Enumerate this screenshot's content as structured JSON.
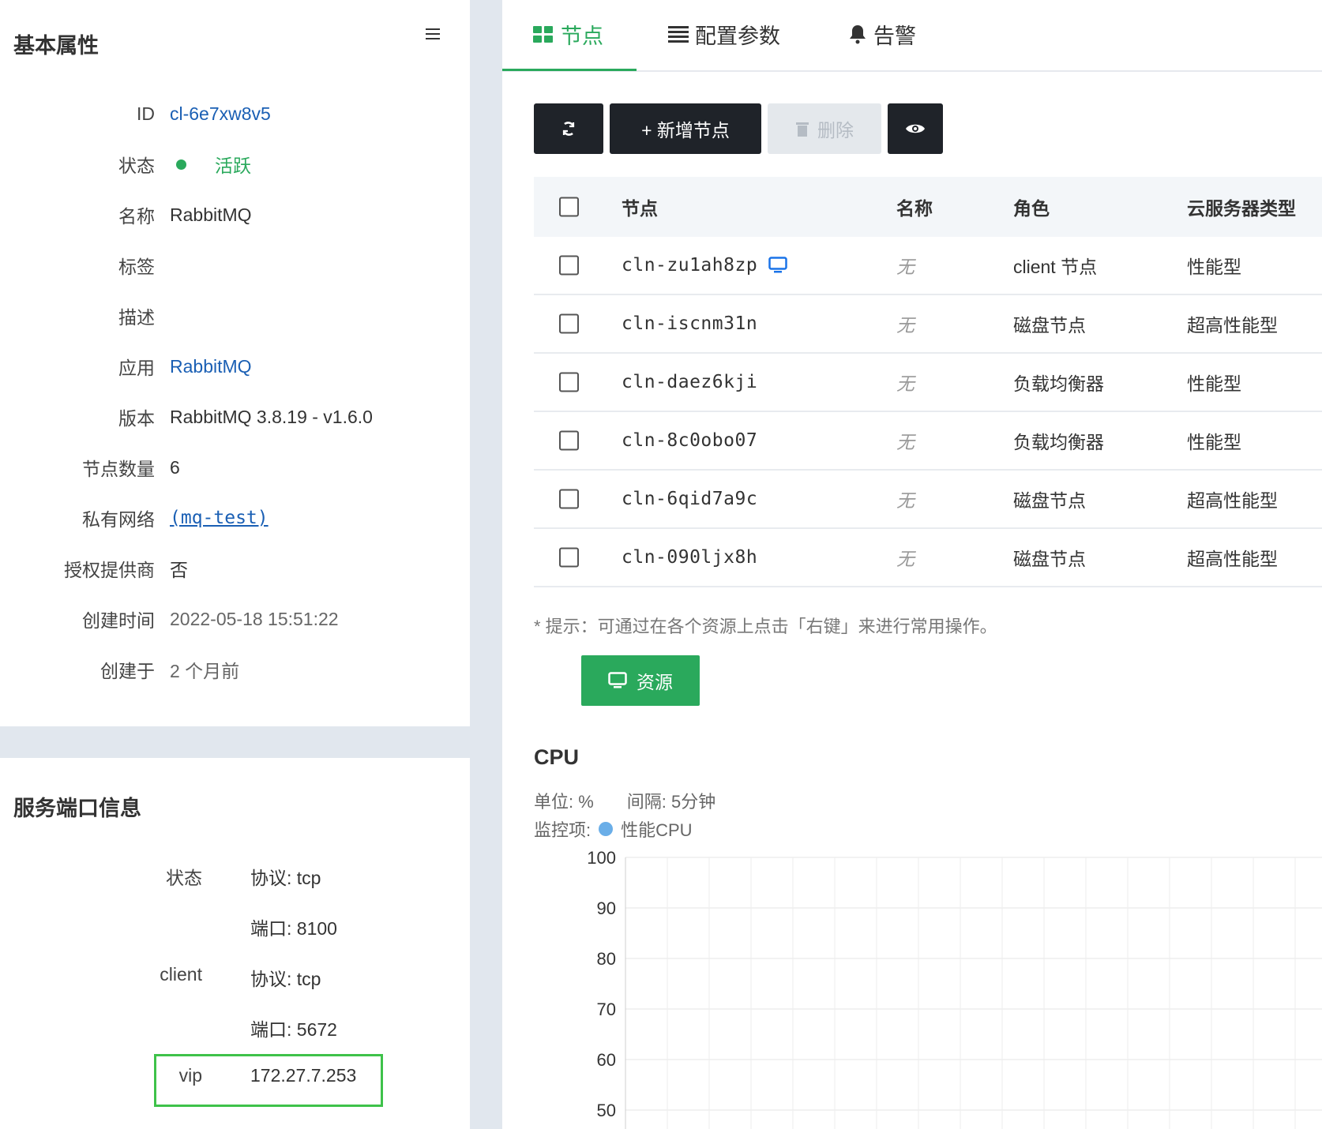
{
  "basic": {
    "title": "基本属性",
    "rows": [
      {
        "label": "ID",
        "value": "cl-6e7xw8v5"
      },
      {
        "label": "状态",
        "value": "活跃"
      },
      {
        "label": "名称",
        "value": "RabbitMQ"
      },
      {
        "label": "标签",
        "value": ""
      },
      {
        "label": "描述",
        "value": ""
      },
      {
        "label": "应用",
        "value": "RabbitMQ"
      },
      {
        "label": "版本",
        "value": "RabbitMQ 3.8.19 - v1.6.0"
      },
      {
        "label": "节点数量",
        "value": "6"
      },
      {
        "label": "私有网络",
        "value": "(mq-test)"
      },
      {
        "label": "授权提供商",
        "value": "否"
      },
      {
        "label": "创建时间",
        "value": "2022-05-18 15:51:22"
      },
      {
        "label": "创建于",
        "value": "2 个月前"
      }
    ]
  },
  "ports": {
    "title": "服务端口信息",
    "rows": [
      {
        "label": "状态",
        "value": "协议: tcp"
      },
      {
        "label": "",
        "value": "端口: 8100"
      },
      {
        "label": "client",
        "value": "协议: tcp"
      },
      {
        "label": "",
        "value": "端口: 5672"
      },
      {
        "label": "vip",
        "value": "172.27.7.253"
      }
    ]
  },
  "tabs": [
    {
      "label": "节点",
      "icon": "grid-icon"
    },
    {
      "label": "配置参数",
      "icon": "list-icon"
    },
    {
      "label": "告警",
      "icon": "bell-icon"
    }
  ],
  "toolbar": {
    "add_label": "+ 新增节点",
    "delete_label": "删除"
  },
  "table": {
    "headers": [
      "节点",
      "名称",
      "角色",
      "云服务器类型"
    ],
    "rows": [
      {
        "node": "cln-zu1ah8zp",
        "name": "无",
        "role": "client 节点",
        "type": "性能型"
      },
      {
        "node": "cln-iscnm31n",
        "name": "无",
        "role": "磁盘节点",
        "type": "超高性能型"
      },
      {
        "node": "cln-daez6kji",
        "name": "无",
        "role": "负载均衡器",
        "type": "性能型"
      },
      {
        "node": "cln-8c0obo07",
        "name": "无",
        "role": "负载均衡器",
        "type": "性能型"
      },
      {
        "node": "cln-6qid7a9c",
        "name": "无",
        "role": "磁盘节点",
        "type": "超高性能型"
      },
      {
        "node": "cln-090ljx8h",
        "name": "无",
        "role": "磁盘节点",
        "type": "超高性能型"
      }
    ]
  },
  "hint": "* 提示：可通过在各个资源上点击「右键」来进行常用操作。",
  "resource_button": "资源",
  "chart_header": {
    "title": "CPU",
    "unit": "单位: %",
    "interval": "间隔: 5分钟",
    "monitor_label": "监控项:",
    "series_name": "性能CPU"
  },
  "chart_data": {
    "type": "line",
    "title": "CPU",
    "ylabel": "",
    "xlabel": "",
    "yticks": [
      100,
      90,
      80,
      70,
      60,
      50
    ],
    "ylim": [
      50,
      100
    ],
    "grid": true,
    "series": [
      {
        "name": "性能CPU",
        "values": []
      }
    ],
    "legend": "top-left",
    "series_color": "#6aaee8"
  },
  "colors": {
    "accent": "#2aa95c",
    "link": "#1a5fb4",
    "dark_button": "#1f2329"
  }
}
